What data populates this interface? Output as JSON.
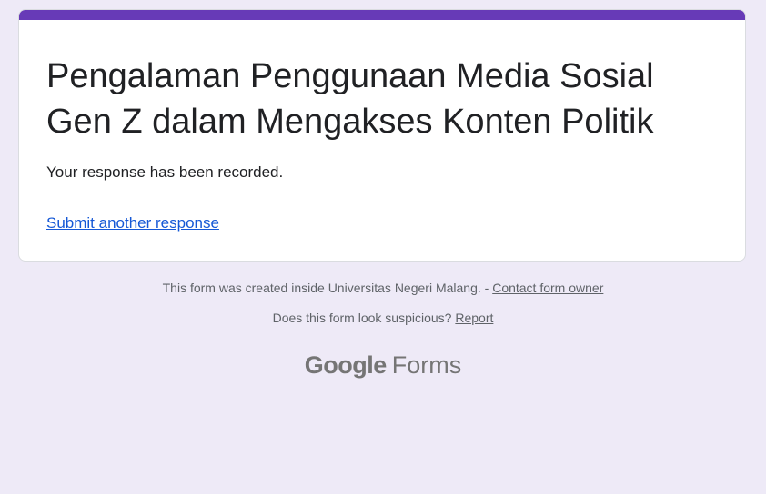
{
  "form": {
    "title": "Pengalaman Penggunaan Media Sosial Gen Z dalam Mengakses Konten Politik",
    "confirmation": "Your response has been recorded.",
    "submit_another": "Submit another response"
  },
  "footer": {
    "created_text": "This form was created inside Universitas Negeri Malang. - ",
    "contact_link": "Contact form owner",
    "suspicious_text": "Does this form look suspicious? ",
    "report_link": "Report"
  },
  "brand": {
    "google": "Google",
    "forms": "Forms"
  },
  "colors": {
    "accent": "#673ab7",
    "background": "#eeeaf7",
    "link": "#1558d6"
  }
}
